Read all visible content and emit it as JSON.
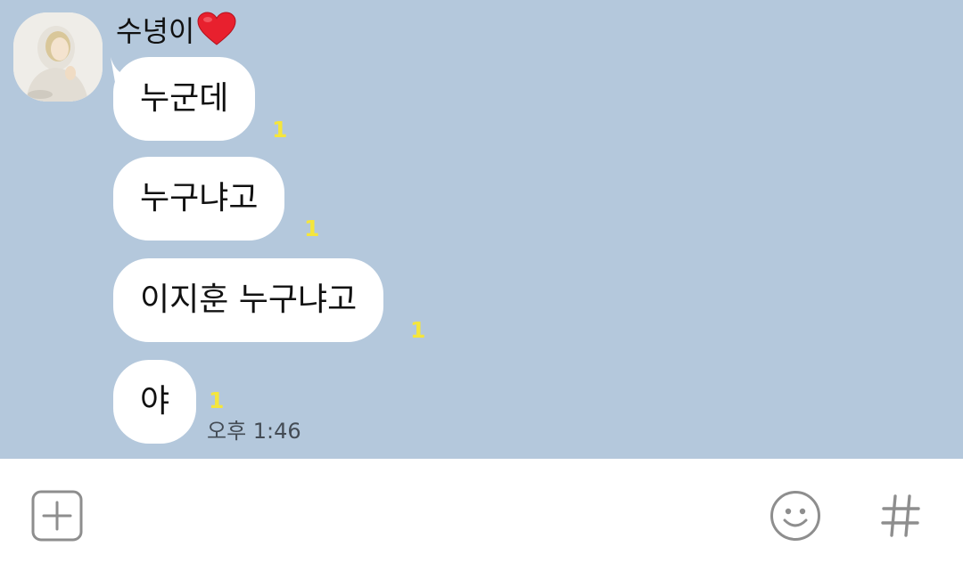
{
  "chat": {
    "sender_name": "수녕이",
    "messages": [
      {
        "text": "누군데",
        "unread": "1"
      },
      {
        "text": "누구냐고",
        "unread": "1"
      },
      {
        "text": "이지훈 누구냐고",
        "unread": "1"
      },
      {
        "text": "야",
        "unread": "1"
      }
    ],
    "last_timestamp": "오후 1:46"
  },
  "input_bar": {
    "icons": [
      "plus-square-icon",
      "emoji-smile-icon",
      "hashtag-icon"
    ]
  },
  "colors": {
    "chat_background": "#b4c8dc",
    "bubble": "#ffffff",
    "unread_count": "#f5e63c",
    "icon_gray": "#8e8e8e"
  }
}
